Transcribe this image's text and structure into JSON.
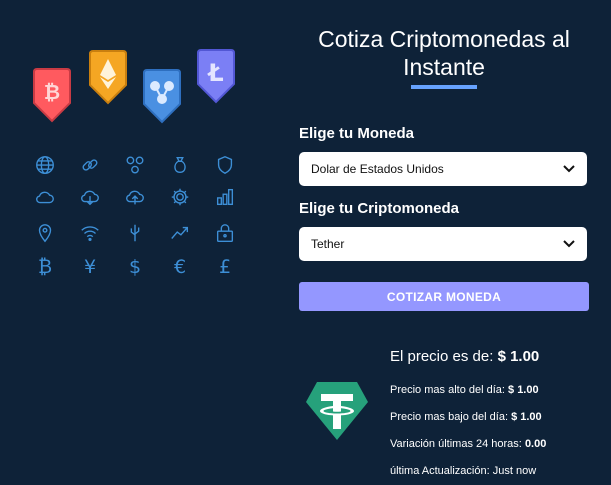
{
  "header": {
    "title_line1": "Cotiza Criptomonedas al",
    "title_line2": "Instante"
  },
  "form": {
    "currency_label": "Elige tu Moneda",
    "currency_value": "Dolar de Estados Unidos",
    "crypto_label": "Elige tu Criptomoneda",
    "crypto_value": "Tether",
    "submit_label": "COTIZAR MONEDA"
  },
  "result": {
    "price_label": "El precio es de:",
    "price_value": "$ 1.00",
    "high_label": "Precio mas alto del día:",
    "high_value": "$ 1.00",
    "low_label": "Precio mas bajo del día:",
    "low_value": "$ 1.00",
    "change_label": "Variación últimas 24 horas:",
    "change_value": "0.00",
    "updated_label": "última Actualización:",
    "updated_value": "Just now"
  },
  "illustration": {
    "badges": [
      "bitcoin-badge",
      "ethereum-badge",
      "ripple-badge",
      "litecoin-badge"
    ],
    "grid_glyphs": {
      "bitcoin": "₿",
      "yen": "¥",
      "dollar": "$",
      "euro": "€",
      "pound": "£"
    },
    "icon_color": "#3d8fd6"
  },
  "colors": {
    "background": "#0e2238",
    "accent_bar": "#66a2fe",
    "button": "#9497ff",
    "tether": "#26a17b"
  }
}
